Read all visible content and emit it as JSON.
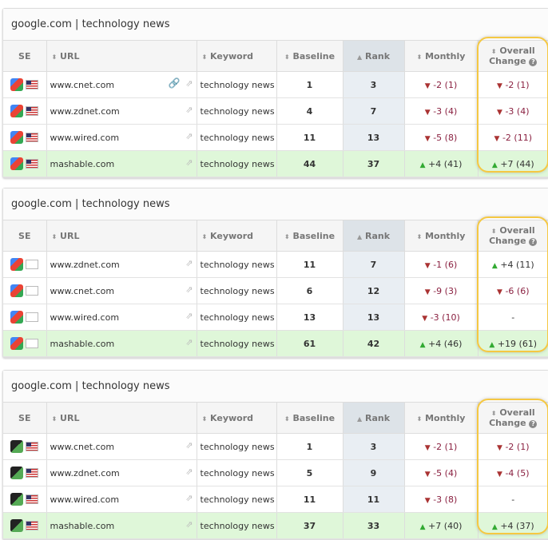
{
  "headers": {
    "se": "SE",
    "url": "URL",
    "keyword": "Keyword",
    "baseline": "Baseline",
    "rank": "Rank",
    "monthly": "Monthly",
    "overall1": "Overall",
    "overall2": "Change"
  },
  "panels": [
    {
      "title": "google.com | technology news",
      "engine_style": "color",
      "flag": "us",
      "rows": [
        {
          "url": "www.cnet.com",
          "link": true,
          "keyword": "technology news",
          "baseline": "1",
          "rank": "3",
          "monthly_dir": "down",
          "monthly": "-2 (1)",
          "overall_dir": "down",
          "overall": "-2 (1)",
          "hl": false
        },
        {
          "url": "www.zdnet.com",
          "keyword": "technology news",
          "baseline": "4",
          "rank": "7",
          "monthly_dir": "down",
          "monthly": "-3 (4)",
          "overall_dir": "down",
          "overall": "-3 (4)",
          "hl": false
        },
        {
          "url": "www.wired.com",
          "keyword": "technology news",
          "baseline": "11",
          "rank": "13",
          "monthly_dir": "down",
          "monthly": "-5 (8)",
          "overall_dir": "down",
          "overall": "-2 (11)",
          "hl": false
        },
        {
          "url": "mashable.com",
          "keyword": "technology news",
          "baseline": "44",
          "rank": "37",
          "monthly_dir": "up",
          "monthly": "+4 (41)",
          "overall_dir": "up",
          "overall": "+7 (44)",
          "hl": true
        }
      ]
    },
    {
      "title": "google.com | technology news",
      "engine_style": "color",
      "flag": "blank",
      "rows": [
        {
          "url": "www.zdnet.com",
          "keyword": "technology news",
          "baseline": "11",
          "rank": "7",
          "monthly_dir": "down",
          "monthly": "-1 (6)",
          "overall_dir": "up",
          "overall": "+4 (11)",
          "hl": false
        },
        {
          "url": "www.cnet.com",
          "keyword": "technology news",
          "baseline": "6",
          "rank": "12",
          "monthly_dir": "down",
          "monthly": "-9 (3)",
          "overall_dir": "down",
          "overall": "-6 (6)",
          "hl": false
        },
        {
          "url": "www.wired.com",
          "keyword": "technology news",
          "baseline": "13",
          "rank": "13",
          "monthly_dir": "down",
          "monthly": "-3 (10)",
          "overall_dir": "none",
          "overall": "-",
          "hl": false
        },
        {
          "url": "mashable.com",
          "keyword": "technology news",
          "baseline": "61",
          "rank": "42",
          "monthly_dir": "up",
          "monthly": "+4 (46)",
          "overall_dir": "up",
          "overall": "+19 (61)",
          "hl": true
        }
      ]
    },
    {
      "title": "google.com | technology news",
      "engine_style": "dark",
      "flag": "us",
      "rows": [
        {
          "url": "www.cnet.com",
          "keyword": "technology news",
          "baseline": "1",
          "rank": "3",
          "monthly_dir": "down",
          "monthly": "-2 (1)",
          "overall_dir": "down",
          "overall": "-2 (1)",
          "hl": false
        },
        {
          "url": "www.zdnet.com",
          "keyword": "technology news",
          "baseline": "5",
          "rank": "9",
          "monthly_dir": "down",
          "monthly": "-5 (4)",
          "overall_dir": "down",
          "overall": "-4 (5)",
          "hl": false
        },
        {
          "url": "www.wired.com",
          "keyword": "technology news",
          "baseline": "11",
          "rank": "11",
          "monthly_dir": "down",
          "monthly": "-3 (8)",
          "overall_dir": "none",
          "overall": "-",
          "hl": false
        },
        {
          "url": "mashable.com",
          "keyword": "technology news",
          "baseline": "37",
          "rank": "33",
          "monthly_dir": "up",
          "monthly": "+7 (40)",
          "overall_dir": "up",
          "overall": "+4 (37)",
          "hl": true
        }
      ]
    }
  ]
}
